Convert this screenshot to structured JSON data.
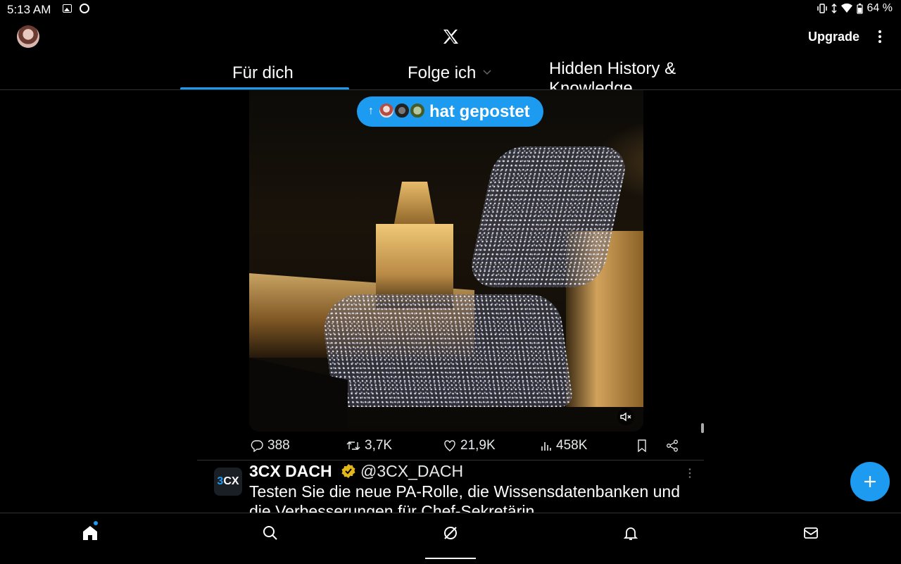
{
  "status_bar": {
    "time": "5:13 AM",
    "battery": "64 %"
  },
  "header": {
    "logo": "x-logo-icon",
    "upgrade_label": "Upgrade"
  },
  "tabs": [
    {
      "label": "Für dich",
      "selected": true
    },
    {
      "label": "Folge ich",
      "selected": false
    },
    {
      "label": "Hidden History & Knowledge",
      "selected": false
    }
  ],
  "post": {
    "posted_pill": "hat gepostet",
    "actions": {
      "replies": "388",
      "reposts": "3,7K",
      "likes": "21,9K",
      "views": "458K"
    }
  },
  "next_tweet": {
    "avatar_text_a": "3",
    "avatar_text_b": "CX",
    "name": "3CX DACH",
    "handle": "@3CX_DACH",
    "text": "Testen Sie die neue PA-Rolle, die Wissensdatenbanken und die Verbesserungen für Chef-Sekretärin"
  },
  "colors": {
    "accent": "#1d9bf0",
    "background": "#000000",
    "text": "#e7e9ea"
  }
}
